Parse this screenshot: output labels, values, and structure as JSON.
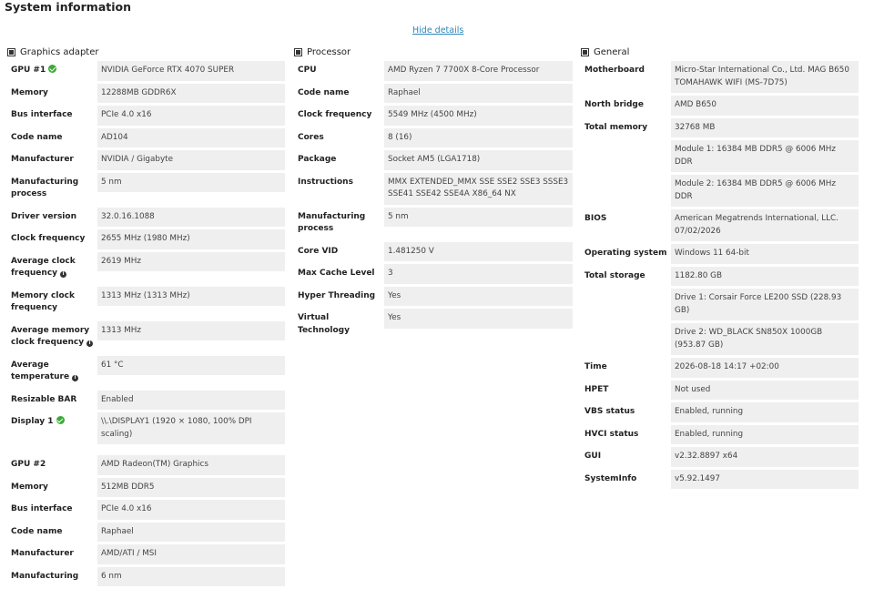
{
  "page": {
    "title": "System information",
    "hide_details": "Hide details"
  },
  "graphics": {
    "header": "Graphics adapter",
    "rows": [
      {
        "label": "GPU #1",
        "badge": "check",
        "values": [
          "NVIDIA GeForce RTX 4070 SUPER"
        ]
      },
      {
        "label": "Memory",
        "values": [
          "12288MB GDDR6X"
        ]
      },
      {
        "label": "Bus interface",
        "values": [
          "PCIe 4.0 x16"
        ]
      },
      {
        "label": "Code name",
        "values": [
          "AD104"
        ]
      },
      {
        "label": "Manufacturer",
        "values": [
          "NVIDIA / Gigabyte"
        ]
      },
      {
        "label": "Manufacturing process",
        "values": [
          "5 nm"
        ]
      },
      {
        "label": "Driver version",
        "values": [
          "32.0.16.1088"
        ]
      },
      {
        "label": "Clock frequency",
        "values": [
          "2655 MHz (1980 MHz)"
        ]
      },
      {
        "label": "Average clock frequency",
        "badge": "info",
        "values": [
          "2619 MHz"
        ]
      },
      {
        "label": "Memory clock frequency",
        "values": [
          "1313 MHz (1313 MHz)"
        ]
      },
      {
        "label": "Average memory clock frequency",
        "badge": "info",
        "values": [
          "1313 MHz"
        ]
      },
      {
        "label": "Average temperature",
        "badge": "info",
        "values": [
          "61 °C"
        ]
      },
      {
        "label": "Resizable BAR",
        "values": [
          "Enabled"
        ]
      },
      {
        "label": "Display 1",
        "badge": "check",
        "values": [
          "\\\\.\\DISPLAY1 (1920 × 1080, 100% DPI scaling)"
        ]
      },
      {
        "label": "GPU #2",
        "values": [
          "AMD Radeon(TM) Graphics"
        ],
        "gap_before": true
      },
      {
        "label": "Memory",
        "values": [
          "512MB DDR5"
        ]
      },
      {
        "label": "Bus interface",
        "values": [
          "PCIe 4.0 x16"
        ]
      },
      {
        "label": "Code name",
        "values": [
          "Raphael"
        ]
      },
      {
        "label": "Manufacturer",
        "values": [
          "AMD/ATI / MSI"
        ]
      },
      {
        "label": "Manufacturing",
        "values": [
          "6 nm"
        ]
      }
    ]
  },
  "processor": {
    "header": "Processor",
    "rows": [
      {
        "label": "CPU",
        "values": [
          "AMD Ryzen 7 7700X 8-Core Processor"
        ]
      },
      {
        "label": "Code name",
        "values": [
          "Raphael"
        ]
      },
      {
        "label": "Clock frequency",
        "values": [
          "5549 MHz (4500 MHz)"
        ]
      },
      {
        "label": "Cores",
        "values": [
          "8 (16)"
        ]
      },
      {
        "label": "Package",
        "values": [
          "Socket AM5 (LGA1718)"
        ]
      },
      {
        "label": "Instructions",
        "values": [
          "MMX EXTENDED_MMX SSE SSE2 SSE3 SSSE3 SSE41 SSE42 SSE4A X86_64 NX"
        ]
      },
      {
        "label": "Manufacturing process",
        "values": [
          "5 nm"
        ]
      },
      {
        "label": "Core VID",
        "values": [
          "1.481250 V"
        ]
      },
      {
        "label": "Max Cache Level",
        "values": [
          "3"
        ]
      },
      {
        "label": "Hyper Threading",
        "values": [
          "Yes"
        ]
      },
      {
        "label": "Virtual Technology",
        "values": [
          "Yes"
        ]
      }
    ]
  },
  "general": {
    "header": "General",
    "rows": [
      {
        "label": "Motherboard",
        "values": [
          "Micro-Star International Co., Ltd. MAG B650 TOMAHAWK WIFI (MS-7D75)"
        ]
      },
      {
        "label": "North bridge",
        "values": [
          "AMD B650"
        ]
      },
      {
        "label": "Total memory",
        "values": [
          "32768 MB",
          "Module 1: 16384 MB DDR5 @ 6006 MHz DDR",
          "Module 2: 16384 MB DDR5 @ 6006 MHz DDR"
        ]
      },
      {
        "label": "BIOS",
        "values": [
          "American Megatrends International, LLC. 07/02/2026"
        ]
      },
      {
        "label": "Operating system",
        "values": [
          "Windows 11 64-bit"
        ]
      },
      {
        "label": "Total storage",
        "values": [
          "1182.80 GB",
          "Drive 1: Corsair Force LE200 SSD (228.93 GB)",
          "Drive 2: WD_BLACK SN850X 1000GB (953.87 GB)"
        ]
      },
      {
        "label": "Time",
        "values": [
          "2026-08-18 14:17 +02:00"
        ]
      },
      {
        "label": "HPET",
        "values": [
          "Not used"
        ]
      },
      {
        "label": "VBS status",
        "values": [
          "Enabled, running"
        ]
      },
      {
        "label": "HVCI status",
        "values": [
          "Enabled, running"
        ]
      },
      {
        "label": "GUI",
        "values": [
          "v2.32.8897 x64"
        ]
      },
      {
        "label": "SystemInfo",
        "values": [
          "v5.92.1497"
        ]
      }
    ]
  },
  "icons": {
    "section": "square-bullet-icon",
    "ok": "check-circle-icon",
    "info": "info-icon"
  },
  "colors": {
    "value_bg": "#efefef",
    "ok": "#3aaa35",
    "link": "#2c86b8"
  }
}
